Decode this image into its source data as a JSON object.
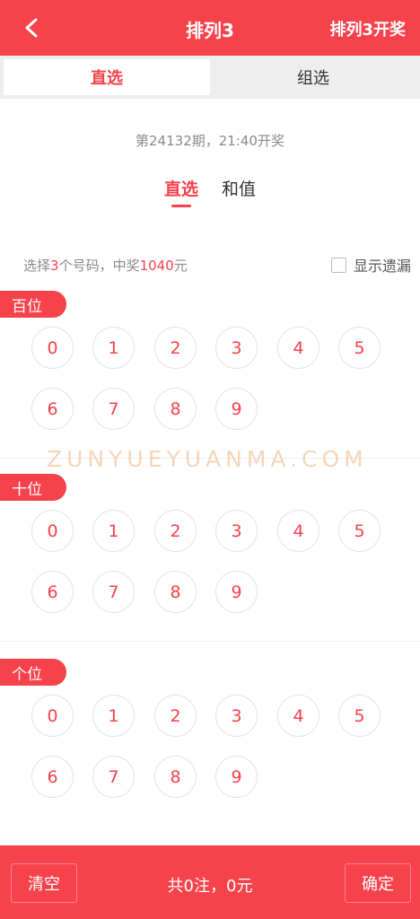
{
  "header": {
    "title": "排列3",
    "draw_link": "排列3开奖",
    "back_icon": "chevron-left-icon"
  },
  "mode_tabs": [
    {
      "label": "直选",
      "active": true
    },
    {
      "label": "组选",
      "active": false
    }
  ],
  "issue_text": "第24132期，21:40开奖",
  "sub_tabs": [
    {
      "label": "直选",
      "active": true
    },
    {
      "label": "和值",
      "active": false
    }
  ],
  "hint": {
    "prefix": "选择",
    "count": "3",
    "middle": "个号码，中奖",
    "prize": "1040",
    "suffix": "元"
  },
  "show_missing": {
    "label": "显示遗漏",
    "checked": false
  },
  "positions": [
    {
      "label": "百位",
      "numbers": [
        "0",
        "1",
        "2",
        "3",
        "4",
        "5",
        "6",
        "7",
        "8",
        "9"
      ]
    },
    {
      "label": "十位",
      "numbers": [
        "0",
        "1",
        "2",
        "3",
        "4",
        "5",
        "6",
        "7",
        "8",
        "9"
      ]
    },
    {
      "label": "个位",
      "numbers": [
        "0",
        "1",
        "2",
        "3",
        "4",
        "5",
        "6",
        "7",
        "8",
        "9"
      ]
    }
  ],
  "watermark": "ZUNYUEYUANMA.COM",
  "footer": {
    "clear_label": "清空",
    "summary": "共0注，0元",
    "confirm_label": "确定"
  },
  "colors": {
    "accent": "#f5424b"
  }
}
